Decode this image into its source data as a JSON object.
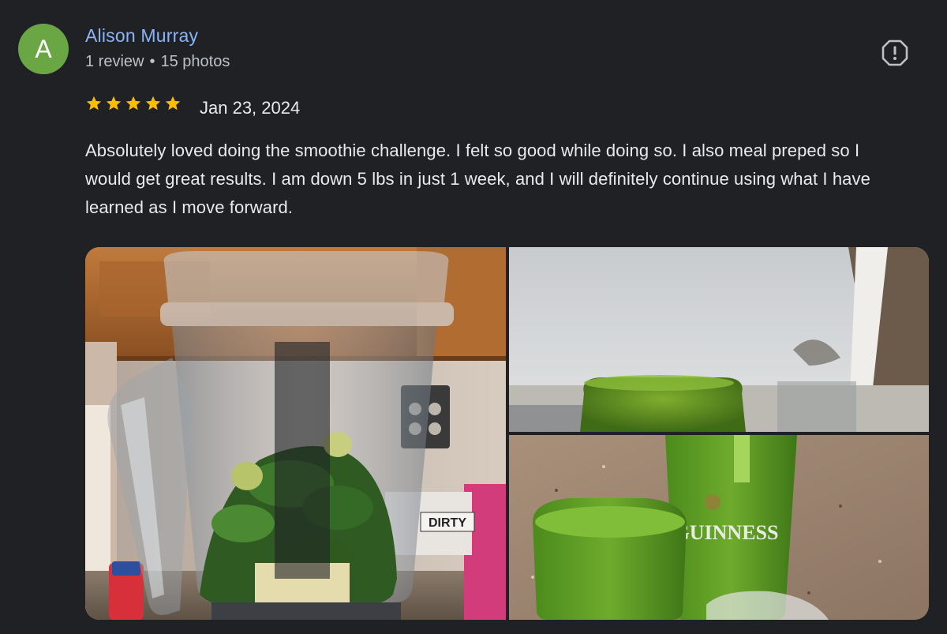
{
  "author": {
    "avatar_letter": "A",
    "avatar_color": "#6ba644",
    "name": "Alison Murray",
    "review_count": "1 review",
    "photo_count": "15 photos"
  },
  "flag_icon": "report-flag-icon",
  "rating": {
    "stars": 5,
    "max": 5,
    "star_color": "#fbbc04"
  },
  "date": "Jan 23, 2024",
  "review_text": "Absolutely loved doing the smoothie challenge. I felt so good while doing so. I also meal preped so I would get great results. I am down 5 lbs in just 1 week, and I will definitely continue using what I have learned as I move forward.",
  "photos": [
    {
      "subject": "blender-with-greens",
      "label": "DIRTY"
    },
    {
      "subject": "green-smoothie-jar-closeup"
    },
    {
      "subject": "green-smoothie-glasses",
      "label": "GUINNESS"
    }
  ]
}
